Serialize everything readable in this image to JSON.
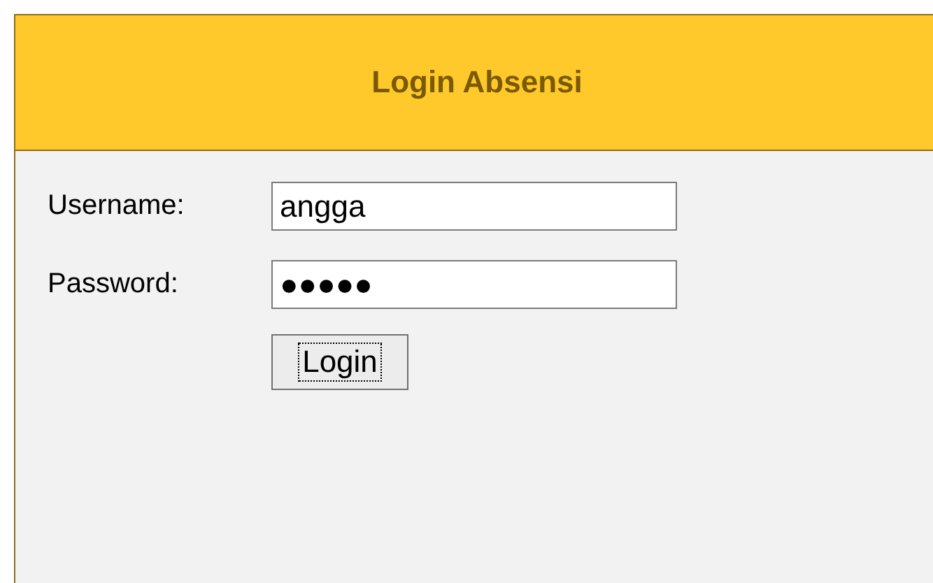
{
  "header": {
    "title": "Login Absensi"
  },
  "fields": [
    {
      "label": "Username:",
      "value": "angga"
    },
    {
      "label": "Password:",
      "value": "●●●●●"
    }
  ],
  "login_button": {
    "label": "Login",
    "focused": true
  }
}
